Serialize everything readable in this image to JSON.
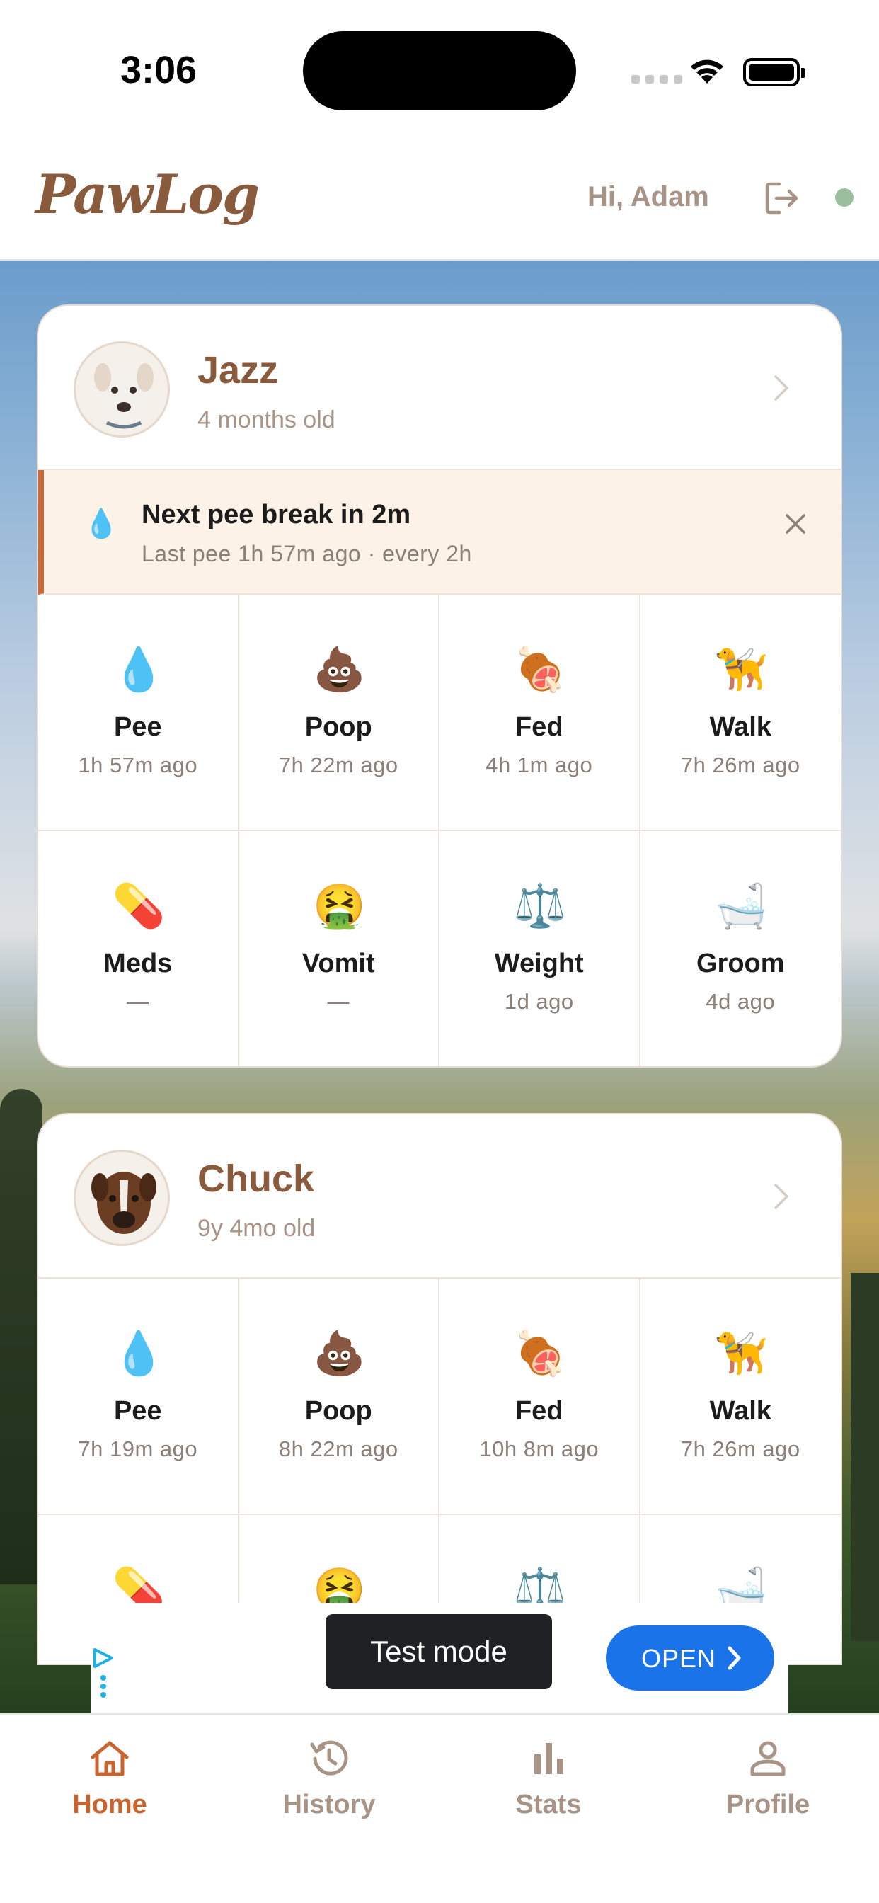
{
  "status": {
    "time": "3:06"
  },
  "header": {
    "logo": "PawLog",
    "greeting": "Hi, Adam"
  },
  "pets": [
    {
      "name": "Jazz",
      "age": "4 months old",
      "alert": {
        "title": "Next pee break in 2m",
        "subtitle": "Last pee 1h 57m ago · every 2h"
      },
      "tiles": [
        {
          "icon": "droplet-icon",
          "glyph": "💧",
          "label": "Pee",
          "sub": "1h 57m ago"
        },
        {
          "icon": "poop-icon",
          "glyph": "💩",
          "label": "Poop",
          "sub": "7h 22m ago"
        },
        {
          "icon": "meat-icon",
          "glyph": "🍖",
          "label": "Fed",
          "sub": "4h 1m ago"
        },
        {
          "icon": "dog-icon",
          "glyph": "🦮",
          "label": "Walk",
          "sub": "7h 26m ago"
        },
        {
          "icon": "pill-icon",
          "glyph": "💊",
          "label": "Meds",
          "sub": "—"
        },
        {
          "icon": "vomit-icon",
          "glyph": "🤮",
          "label": "Vomit",
          "sub": "—"
        },
        {
          "icon": "scale-icon",
          "glyph": "⚖️",
          "label": "Weight",
          "sub": "1d ago"
        },
        {
          "icon": "bathtub-icon",
          "glyph": "🛁",
          "label": "Groom",
          "sub": "4d ago"
        }
      ]
    },
    {
      "name": "Chuck",
      "age": "9y 4mo old",
      "tiles": [
        {
          "icon": "droplet-icon",
          "glyph": "💧",
          "label": "Pee",
          "sub": "7h 19m ago"
        },
        {
          "icon": "poop-icon",
          "glyph": "💩",
          "label": "Poop",
          "sub": "8h 22m ago"
        },
        {
          "icon": "meat-icon",
          "glyph": "🍖",
          "label": "Fed",
          "sub": "10h 8m ago"
        },
        {
          "icon": "dog-icon",
          "glyph": "🦮",
          "label": "Walk",
          "sub": "7h 26m ago"
        },
        {
          "icon": "pill-icon",
          "glyph": "💊"
        },
        {
          "icon": "vomit-icon",
          "glyph": "🤮"
        },
        {
          "icon": "scale-icon",
          "glyph": "⚖️"
        },
        {
          "icon": "bathtub-icon",
          "glyph": "🛁"
        }
      ]
    }
  ],
  "ad": {
    "test_label": "Test mode",
    "open_label": "OPEN"
  },
  "nav": [
    {
      "icon": "home-icon",
      "label": "Home",
      "active": true
    },
    {
      "icon": "history-icon",
      "label": "History",
      "active": false
    },
    {
      "icon": "stats-icon",
      "label": "Stats",
      "active": false
    },
    {
      "icon": "profile-icon",
      "label": "Profile",
      "active": false
    }
  ],
  "colors": {
    "brand": "#8a5a3c",
    "accent": "#c8642e",
    "online": "#9bbe9d",
    "alert_bg": "#fcf2e7",
    "ad_button": "#1a73e8"
  }
}
